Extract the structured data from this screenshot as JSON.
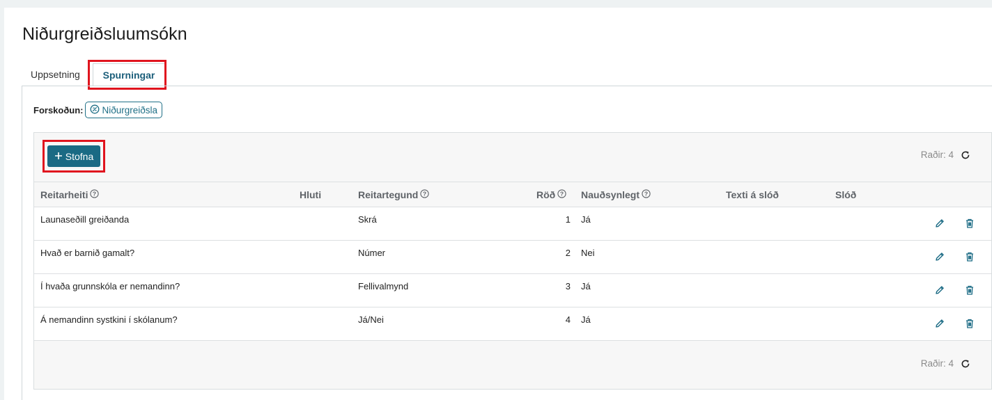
{
  "title": "Niðurgreiðsluumsókn",
  "tabs": [
    {
      "label": "Uppsetning",
      "active": false
    },
    {
      "label": "Spurningar",
      "active": true
    }
  ],
  "preview": {
    "label": "Forskoðun:",
    "chip_label": "Niðurgreiðsla",
    "chip_icon": "settings-circle-icon"
  },
  "toolbar": {
    "create_label": "Stofna",
    "create_icon": "plus-icon",
    "rowcount": "Raðir: 4",
    "refresh_icon": "refresh-icon"
  },
  "columns": [
    {
      "key": "name",
      "label": "Reitarheiti",
      "help": true
    },
    {
      "key": "part",
      "label": "Hluti",
      "help": false
    },
    {
      "key": "type",
      "label": "Reitartegund",
      "help": true
    },
    {
      "key": "order",
      "label": "Röð",
      "help": true
    },
    {
      "key": "required",
      "label": "Nauðsynlegt",
      "help": true
    },
    {
      "key": "link_text",
      "label": "Texti á slóð",
      "help": false
    },
    {
      "key": "link",
      "label": "Slóð",
      "help": false
    }
  ],
  "rows": [
    {
      "name": "Launaseðill greiðanda",
      "part": "",
      "type": "Skrá",
      "order": "1",
      "required": "Já",
      "link_text": "",
      "link": ""
    },
    {
      "name": "Hvað er barnið gamalt?",
      "part": "",
      "type": "Númer",
      "order": "2",
      "required": "Nei",
      "link_text": "",
      "link": ""
    },
    {
      "name": "Í hvaða grunnskóla er nemandinn?",
      "part": "",
      "type": "Fellivalmynd",
      "order": "3",
      "required": "Já",
      "link_text": "",
      "link": ""
    },
    {
      "name": "Á nemandinn systkini í skólanum?",
      "part": "",
      "type": "Já/Nei",
      "order": "4",
      "required": "Já",
      "link_text": "",
      "link": ""
    }
  ],
  "footer": {
    "rowcount": "Raðir: 4"
  },
  "colors": {
    "accent": "#1a6a84",
    "highlight": "#e0141e",
    "header_text": "#5f6368"
  }
}
